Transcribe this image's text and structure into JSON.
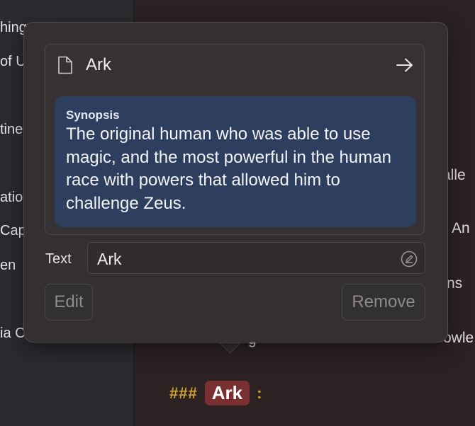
{
  "sidebar": {
    "fragments": [
      "hing",
      "of U",
      "tine",
      "atio",
      "Cap",
      "en",
      "ia C"
    ]
  },
  "editor": {
    "fragments": [
      "alle",
      "An",
      "ns",
      "g",
      "owle"
    ],
    "markdown": {
      "hashes": "###",
      "tag": "Ark",
      "colon": ":"
    }
  },
  "popover": {
    "card": {
      "title": "Ark",
      "icons": {
        "doc": "document-icon",
        "open": "arrow-right-icon"
      },
      "synopsis_label": "Synopsis",
      "synopsis_text": "The original human who was able to use magic, and the most powerful in the human race with powers that allowed him to challenge Zeus."
    },
    "text_field": {
      "label": "Text",
      "value": "Ark",
      "icon": "edit-circle-icon"
    },
    "buttons": {
      "edit": "Edit",
      "remove": "Remove"
    }
  },
  "colors": {
    "popover_bg": "#343032",
    "synopsis_bg": "#2e3e5e",
    "tag_bg": "#7a2f30",
    "markdown_accent": "#d4a52b"
  }
}
